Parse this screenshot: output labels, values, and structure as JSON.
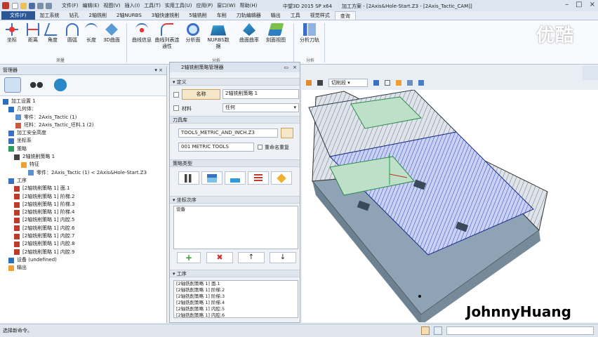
{
  "window": {
    "title": "中望3D 2015 SP x64",
    "doc": "加工方案 - [2Axis&Hole-Start.Z3 - [2Axis_Tactic_CAM]]"
  },
  "menu": [
    "文件(F)",
    "编辑(E)",
    "视图(V)",
    "插入(I)",
    "工具(T)",
    "实用工具(U)",
    "应用(P)",
    "窗口(W)",
    "帮助(H)"
  ],
  "tabs": [
    "文件(F)",
    "加工系统",
    "钻孔",
    "2轴铣削",
    "2轴NURBS",
    "3轴快速铣削",
    "5轴铣削",
    "车削",
    "刀轨编辑器",
    "输出",
    "工具",
    "视觉样式",
    "查询"
  ],
  "ribbon": {
    "buttons": [
      "坐标",
      "距离",
      "角度",
      "圆弧",
      "长度",
      "3D曲面",
      "曲线信息",
      "曲线列表连通性",
      "分析面",
      "NURBS数据",
      "曲面曲率",
      "刻面视图",
      "分析刀轨"
    ],
    "groups": [
      "测量",
      "",
      "分析",
      "分析"
    ]
  },
  "watermark": "优酷",
  "manager": {
    "title": "管理器",
    "tree": [
      "加工设置 1",
      "几何体：",
      "零件：2Axis_Tactic (1)",
      "坯料：2Axis_Tactic_坯料.1 (2)",
      "加工安全高度",
      "坐标系",
      "策略",
      "2轴铣削策略 1",
      "特征",
      "零件：2Axis_Tactic (1) < 2Axis&Hole-Start.Z3",
      "工序",
      "[2轴铣削策略 1] 面.1",
      "[2轴铣削策略 1] 阶梯.2",
      "[2轴铣削策略 1] 阶梯.3",
      "[2轴铣削策略 1] 阶梯.4",
      "[2轴铣削策略 1] 内腔.5",
      "[2轴铣削策略 1] 内腔.6",
      "[2轴铣削策略 1] 内腔.7",
      "[2轴铣削策略 1] 内腔.8",
      "[2轴铣削策略 1] 内腔.9",
      "设备 (undefined)",
      "输出"
    ]
  },
  "strategy": {
    "title": "2轴铣削策略管理器",
    "def": "定义",
    "name_btn": "名称",
    "name_val": "2轴铣削策略 1",
    "material": "材料",
    "material_val": "任何",
    "toollib": "刀具库",
    "lib1": "TOOLS_METRIC_AND_INCH.Z3",
    "lib2": "001 METRIC TOOLS",
    "dup": "重命名重复",
    "type": "策略类型",
    "coord": "坐标次序",
    "device": "设备",
    "ops_title": "工序",
    "ops": [
      "[2轴铣削策略 1] 面.1",
      "[2轴铣削策略 1] 阶梯.2",
      "[2轴铣削策略 1] 阶梯.3",
      "[2轴铣削策略 1] 阶梯.4",
      "[2轴铣削策略 1] 内腔.5",
      "[2轴铣削策略 1] 内腔.6"
    ]
  },
  "viewtb": {
    "mode": "切削段"
  },
  "status": "选择新命令。",
  "author": "JohnnyHuang"
}
